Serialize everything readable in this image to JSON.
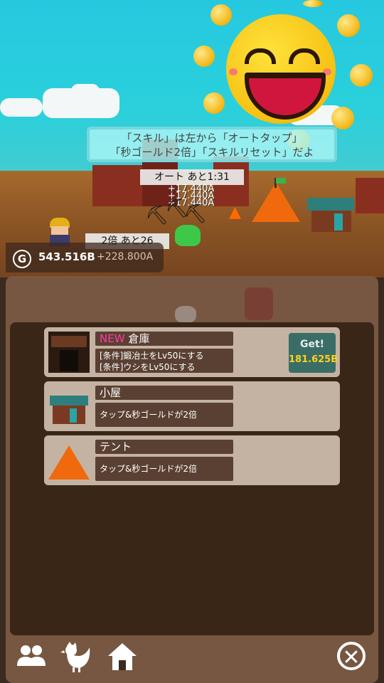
{
  "hint": {
    "line1": "「スキル」は左から「オートタップ」",
    "line2": "「秒ゴールド2倍」「スキルリセット」だよ"
  },
  "scene": {
    "auto_timer": "オート あと1:31",
    "gains": [
      "+17.440A",
      "+17.440A",
      "+17.440A"
    ],
    "double_timer": "2倍 あと26"
  },
  "currency": {
    "icon": "gold-coin-icon",
    "symbol": "G",
    "gold": "543.516B",
    "rate": "+228.800A"
  },
  "items": [
    {
      "new_label": "NEW",
      "name": "倉庫",
      "icon": "warehouse-icon",
      "conditions": [
        "[条件]鍛冶士をLv50にする",
        "[条件]ウシをLv50にする"
      ],
      "button_label": "Get!",
      "price": "181.625B"
    },
    {
      "name": "小屋",
      "icon": "hut-icon",
      "description": "タップ&秒ゴールドが2倍"
    },
    {
      "name": "テント",
      "icon": "tent-icon",
      "description": "タップ&秒ゴールドが2倍"
    }
  ],
  "bottom_nav": {
    "friends_icon": "people-icon",
    "chicken_icon": "chicken-icon",
    "home_icon": "house-icon",
    "close_glyph": "✕"
  },
  "colors": {
    "sky": "#26c8df",
    "ground": "#8a5424",
    "new_accent": "#ff3aa8",
    "price": "#ffd21c",
    "get_button": "#3a6d66"
  }
}
